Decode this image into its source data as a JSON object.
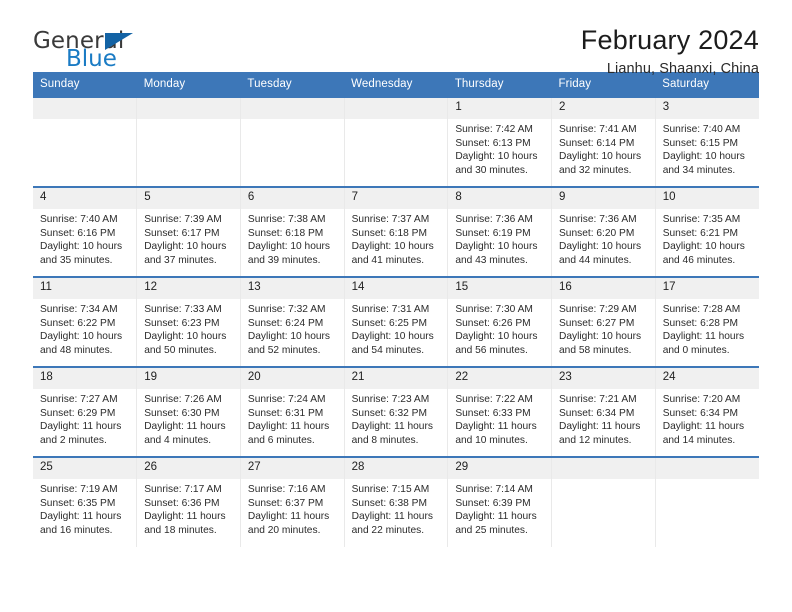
{
  "brand": {
    "name_top": "General",
    "name_bottom": "Blue",
    "accent_color": "#1a7bc4",
    "triangle_color": "#1363a5"
  },
  "header": {
    "title": "February 2024",
    "subtitle": "Lianhu, Shaanxi, China",
    "header_bg_color": "#3d77b8",
    "daynum_bg_color": "#f0f0f0"
  },
  "weekdays": [
    "Sunday",
    "Monday",
    "Tuesday",
    "Wednesday",
    "Thursday",
    "Friday",
    "Saturday"
  ],
  "labels": {
    "sunrise_prefix": "Sunrise:",
    "sunset_prefix": "Sunset:",
    "daylight_prefix": "Daylight:"
  },
  "weeks": [
    [
      {
        "day": "",
        "blank": true
      },
      {
        "day": "",
        "blank": true
      },
      {
        "day": "",
        "blank": true
      },
      {
        "day": "",
        "blank": true
      },
      {
        "day": "1",
        "sunrise": "Sunrise: 7:42 AM",
        "sunset": "Sunset: 6:13 PM",
        "daylight": "Daylight: 10 hours and 30 minutes."
      },
      {
        "day": "2",
        "sunrise": "Sunrise: 7:41 AM",
        "sunset": "Sunset: 6:14 PM",
        "daylight": "Daylight: 10 hours and 32 minutes."
      },
      {
        "day": "3",
        "sunrise": "Sunrise: 7:40 AM",
        "sunset": "Sunset: 6:15 PM",
        "daylight": "Daylight: 10 hours and 34 minutes."
      }
    ],
    [
      {
        "day": "4",
        "sunrise": "Sunrise: 7:40 AM",
        "sunset": "Sunset: 6:16 PM",
        "daylight": "Daylight: 10 hours and 35 minutes."
      },
      {
        "day": "5",
        "sunrise": "Sunrise: 7:39 AM",
        "sunset": "Sunset: 6:17 PM",
        "daylight": "Daylight: 10 hours and 37 minutes."
      },
      {
        "day": "6",
        "sunrise": "Sunrise: 7:38 AM",
        "sunset": "Sunset: 6:18 PM",
        "daylight": "Daylight: 10 hours and 39 minutes."
      },
      {
        "day": "7",
        "sunrise": "Sunrise: 7:37 AM",
        "sunset": "Sunset: 6:18 PM",
        "daylight": "Daylight: 10 hours and 41 minutes."
      },
      {
        "day": "8",
        "sunrise": "Sunrise: 7:36 AM",
        "sunset": "Sunset: 6:19 PM",
        "daylight": "Daylight: 10 hours and 43 minutes."
      },
      {
        "day": "9",
        "sunrise": "Sunrise: 7:36 AM",
        "sunset": "Sunset: 6:20 PM",
        "daylight": "Daylight: 10 hours and 44 minutes."
      },
      {
        "day": "10",
        "sunrise": "Sunrise: 7:35 AM",
        "sunset": "Sunset: 6:21 PM",
        "daylight": "Daylight: 10 hours and 46 minutes."
      }
    ],
    [
      {
        "day": "11",
        "sunrise": "Sunrise: 7:34 AM",
        "sunset": "Sunset: 6:22 PM",
        "daylight": "Daylight: 10 hours and 48 minutes."
      },
      {
        "day": "12",
        "sunrise": "Sunrise: 7:33 AM",
        "sunset": "Sunset: 6:23 PM",
        "daylight": "Daylight: 10 hours and 50 minutes."
      },
      {
        "day": "13",
        "sunrise": "Sunrise: 7:32 AM",
        "sunset": "Sunset: 6:24 PM",
        "daylight": "Daylight: 10 hours and 52 minutes."
      },
      {
        "day": "14",
        "sunrise": "Sunrise: 7:31 AM",
        "sunset": "Sunset: 6:25 PM",
        "daylight": "Daylight: 10 hours and 54 minutes."
      },
      {
        "day": "15",
        "sunrise": "Sunrise: 7:30 AM",
        "sunset": "Sunset: 6:26 PM",
        "daylight": "Daylight: 10 hours and 56 minutes."
      },
      {
        "day": "16",
        "sunrise": "Sunrise: 7:29 AM",
        "sunset": "Sunset: 6:27 PM",
        "daylight": "Daylight: 10 hours and 58 minutes."
      },
      {
        "day": "17",
        "sunrise": "Sunrise: 7:28 AM",
        "sunset": "Sunset: 6:28 PM",
        "daylight": "Daylight: 11 hours and 0 minutes."
      }
    ],
    [
      {
        "day": "18",
        "sunrise": "Sunrise: 7:27 AM",
        "sunset": "Sunset: 6:29 PM",
        "daylight": "Daylight: 11 hours and 2 minutes."
      },
      {
        "day": "19",
        "sunrise": "Sunrise: 7:26 AM",
        "sunset": "Sunset: 6:30 PM",
        "daylight": "Daylight: 11 hours and 4 minutes."
      },
      {
        "day": "20",
        "sunrise": "Sunrise: 7:24 AM",
        "sunset": "Sunset: 6:31 PM",
        "daylight": "Daylight: 11 hours and 6 minutes."
      },
      {
        "day": "21",
        "sunrise": "Sunrise: 7:23 AM",
        "sunset": "Sunset: 6:32 PM",
        "daylight": "Daylight: 11 hours and 8 minutes."
      },
      {
        "day": "22",
        "sunrise": "Sunrise: 7:22 AM",
        "sunset": "Sunset: 6:33 PM",
        "daylight": "Daylight: 11 hours and 10 minutes."
      },
      {
        "day": "23",
        "sunrise": "Sunrise: 7:21 AM",
        "sunset": "Sunset: 6:34 PM",
        "daylight": "Daylight: 11 hours and 12 minutes."
      },
      {
        "day": "24",
        "sunrise": "Sunrise: 7:20 AM",
        "sunset": "Sunset: 6:34 PM",
        "daylight": "Daylight: 11 hours and 14 minutes."
      }
    ],
    [
      {
        "day": "25",
        "sunrise": "Sunrise: 7:19 AM",
        "sunset": "Sunset: 6:35 PM",
        "daylight": "Daylight: 11 hours and 16 minutes."
      },
      {
        "day": "26",
        "sunrise": "Sunrise: 7:17 AM",
        "sunset": "Sunset: 6:36 PM",
        "daylight": "Daylight: 11 hours and 18 minutes."
      },
      {
        "day": "27",
        "sunrise": "Sunrise: 7:16 AM",
        "sunset": "Sunset: 6:37 PM",
        "daylight": "Daylight: 11 hours and 20 minutes."
      },
      {
        "day": "28",
        "sunrise": "Sunrise: 7:15 AM",
        "sunset": "Sunset: 6:38 PM",
        "daylight": "Daylight: 11 hours and 22 minutes."
      },
      {
        "day": "29",
        "sunrise": "Sunrise: 7:14 AM",
        "sunset": "Sunset: 6:39 PM",
        "daylight": "Daylight: 11 hours and 25 minutes."
      },
      {
        "day": "",
        "blank": true
      },
      {
        "day": "",
        "blank": true
      }
    ]
  ]
}
